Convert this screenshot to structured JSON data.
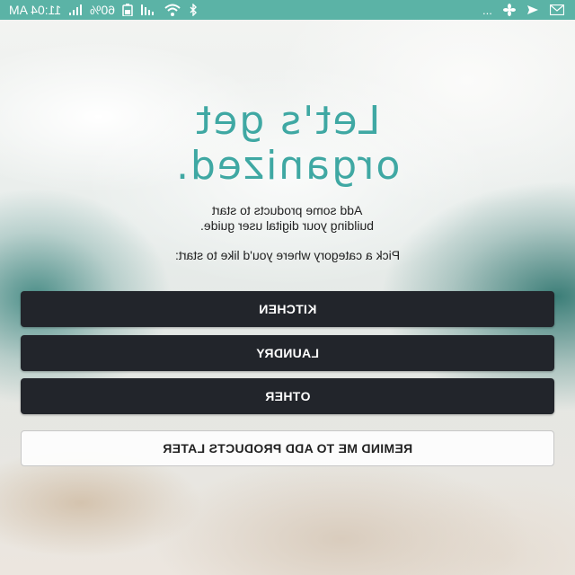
{
  "status_bar": {
    "time": "11:04 AM",
    "battery": "60%",
    "overflow": "...",
    "background_color": "#5bb3a6"
  },
  "heading": {
    "line1": "Let's get",
    "line2": "organized.",
    "color": "#3fa8a3"
  },
  "intro": {
    "line1": "Add some products to start",
    "line2": "building your digital user guide.",
    "prompt": "Pick a category where you'd like to start:"
  },
  "categories": [
    {
      "label": "KITCHEN"
    },
    {
      "label": "LAUNDRY"
    },
    {
      "label": "OTHER"
    }
  ],
  "remind_label": "REMIND ME TO ADD PRODUCTS LATER",
  "colors": {
    "button_dark": "#22252b",
    "button_light": "#ffffff"
  }
}
